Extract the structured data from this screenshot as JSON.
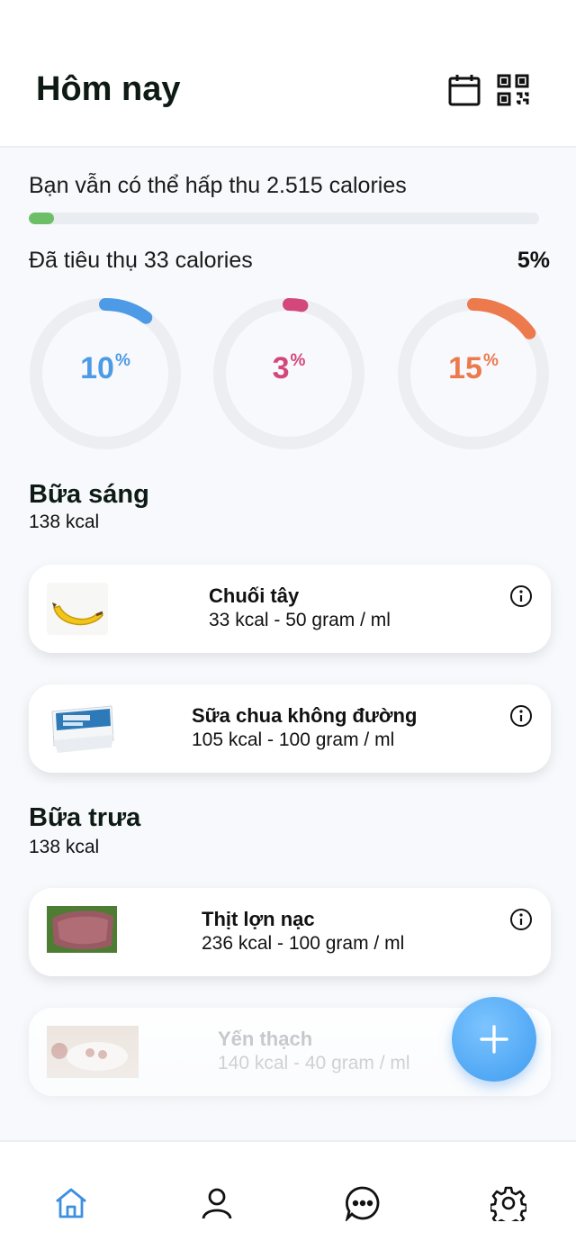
{
  "header": {
    "title": "Hôm nay",
    "icons": [
      "calendar-icon",
      "qr-code-icon"
    ]
  },
  "summary": {
    "remaining_text": "Bạn vẫn có thể hấp thu 2.515 calories",
    "progress_fraction": 0.05,
    "consumed_text": "Đã tiêu thụ 33 calories",
    "consumed_percent": "5%"
  },
  "rings": [
    {
      "value": "10",
      "unit": "%",
      "fraction": 0.1,
      "color": "#4d9be6"
    },
    {
      "value": "3",
      "unit": "%",
      "fraction": 0.03,
      "color": "#d4477a"
    },
    {
      "value": "15",
      "unit": "%",
      "fraction": 0.15,
      "color": "#ec7a4c"
    }
  ],
  "meals": [
    {
      "title": "Bữa sáng",
      "kcal": "138 kcal",
      "items": [
        {
          "name": "Chuối tây",
          "detail": "33 kcal - 50 gram / ml",
          "image": "banana-image"
        },
        {
          "name": "Sữa chua không đường",
          "detail": "105 kcal - 100 gram / ml",
          "image": "yogurt-image"
        }
      ]
    },
    {
      "title": "Bữa trưa",
      "kcal": "138 kcal",
      "items": [
        {
          "name": "Thịt lợn nạc",
          "detail": "236 kcal - 100 gram / ml",
          "image": "pork-image"
        },
        {
          "name": "Yến thạch",
          "detail": "140 kcal - 40 gram / ml",
          "image": "bird-nest-image"
        }
      ]
    }
  ],
  "fab": {
    "icon": "plus-icon"
  },
  "nav": {
    "items": [
      "home-icon",
      "profile-icon",
      "chat-icon",
      "settings-icon"
    ],
    "active": "home-icon",
    "active_color": "#3d8fe0"
  }
}
